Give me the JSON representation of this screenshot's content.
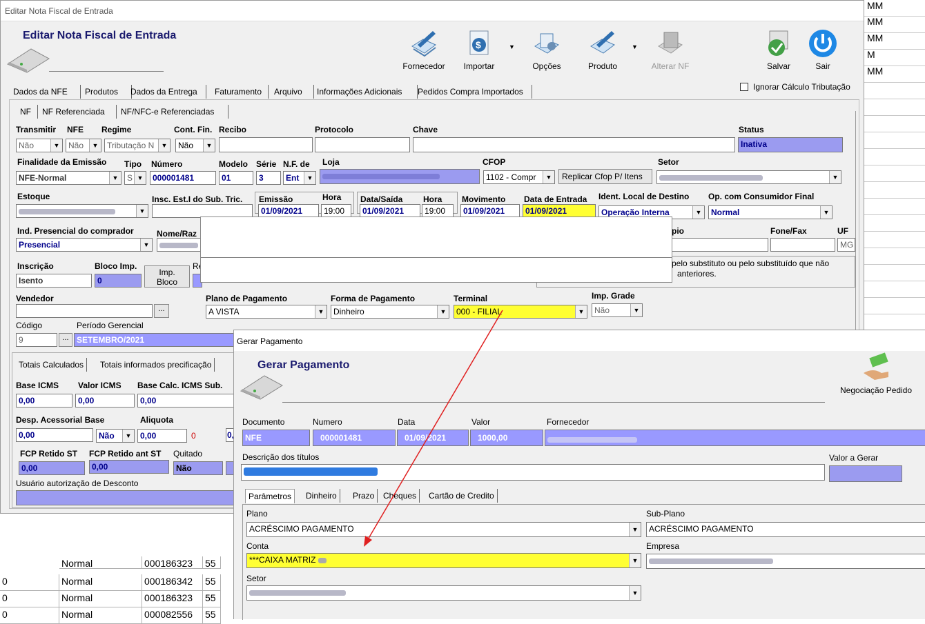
{
  "bg": {
    "right_col_items": [
      "MM",
      "MM",
      "M",
      "MM"
    ],
    "rows": [
      {
        "a": "0",
        "b": "Normal",
        "c": "000186342",
        "d": "55"
      },
      {
        "a": "0",
        "b": "Normal",
        "c": "000186323",
        "d": "55"
      },
      {
        "a": "0",
        "b": "Normal",
        "c": "000082556",
        "d": "55"
      }
    ],
    "partial_row": {
      "b": "Normal",
      "c": "000186323",
      "d": "55"
    }
  },
  "main": {
    "window_title": "Editar Nota Fiscal de Entrada",
    "header_title": "Editar Nota Fiscal de Entrada",
    "toolbar": {
      "fornecedor": "Fornecedor",
      "importar": "Importar",
      "opcoes": "Opções",
      "produto": "Produto",
      "alterar_nf": "Alterar NF",
      "salvar": "Salvar",
      "sair": "Sair"
    },
    "ignorar": "Ignorar Cálculo Tributação",
    "tabs": [
      "Dados da NFE",
      "Produtos",
      "Dados da Entrega",
      "Faturamento",
      "Arquivo",
      "Informações Adicionais",
      "Pedidos Compra Importados"
    ],
    "subtabs": [
      "NF",
      "NF Referenciada",
      "NF/NFC-e Referenciadas"
    ],
    "r1": {
      "transmitir_lbl": "Transmitir",
      "nfe_lbl": "NFE",
      "regime_lbl": "Regime",
      "contfin_lbl": "Cont. Fin.",
      "recibo_lbl": "Recibo",
      "protocolo_lbl": "Protocolo",
      "chave_lbl": "Chave",
      "status_lbl": "Status",
      "transmitir": "Não",
      "nfe": "Não",
      "regime": "Tributação N",
      "contfin": "Não",
      "status": "Inativa"
    },
    "r2": {
      "finalidade_lbl": "Finalidade da Emissão",
      "tipo_lbl": "Tipo",
      "numero_lbl": "Número",
      "modelo_lbl": "Modelo",
      "serie_lbl": "Série",
      "nfde_lbl": "N.F. de",
      "loja_lbl": "Loja",
      "cfop_lbl": "CFOP",
      "setor_lbl": "Setor",
      "finalidade": "NFE-Normal",
      "tipo": "S",
      "numero": "000001481",
      "modelo": "01",
      "serie": "3",
      "nfde": "Ent",
      "cfop": "1102 - Compr",
      "replicar": "Replicar Cfop P/ Itens"
    },
    "r3": {
      "estoque_lbl": "Estoque",
      "insc_sub_lbl": "Insc. Est.I do Sub. Tric.",
      "emissao_lbl": "Emissão",
      "hora_lbl": "Hora",
      "datasaida_lbl": "Data/Saída",
      "hora2_lbl": "Hora",
      "movimento_lbl": "Movimento",
      "dataentrada_lbl": "Data de Entrada",
      "ident_lbl": "Ident. Local de Destino",
      "opcons_lbl": "Op. com Consumidor Final",
      "emissao": "01/09/2021",
      "hora": "19:00",
      "datasaida": "01/09/2021",
      "hora2": "19:00",
      "movimento": "01/09/2021",
      "dataentrada": "01/09/2021",
      "ident": "Operação Interna",
      "opcons": "Normal"
    },
    "r4": {
      "indpres_lbl": "Ind. Presencial do comprador",
      "nomeraz_lbl": "Nome/Raz",
      "municipio_lbl": "pio",
      "fone_lbl": "Fone/Fax",
      "uf_lbl": "UF",
      "indpres": "Presencial",
      "uf": "MG"
    },
    "r5": {
      "inscricao_lbl": "Inscrição",
      "bloco_lbl": "Bloco Imp.",
      "re_lbl": "Re",
      "inscricao": "Isento",
      "bloco": "0",
      "imp_bloco": "Imp.\nBloco",
      "info_text1": "pelo substituto ou pelo substituído que não",
      "info_text2": "anteriores."
    },
    "r6": {
      "vendedor_lbl": "Vendedor",
      "plano_lbl": "Plano de Pagamento",
      "forma_lbl": "Forma de Pagamento",
      "terminal_lbl": "Terminal",
      "impgrade_lbl": "Imp. Grade",
      "plano": "A VISTA",
      "forma": "Dinheiro",
      "terminal": "000 - FILIAL",
      "impgrade": "Não"
    },
    "r7": {
      "codigo_lbl": "Código",
      "periodo_lbl": "Período Gerencial",
      "codigo": "9",
      "periodo": "SETEMBRO/2021"
    },
    "tot_tabs": [
      "Totais Calculados",
      "Totais informados precificação"
    ],
    "tot": {
      "base_icms_lbl": "Base ICMS",
      "valor_icms_lbl": "Valor ICMS",
      "base_sub_lbl": "Base Calc. ICMS Sub.",
      "base_icms": "0,00",
      "valor_icms": "0,00",
      "base_sub": "0,00",
      "desp_lbl": "Desp. Acessorial Base",
      "aliquota_lbl": "Aliquota",
      "desp": "0,00",
      "desp_sel": "Não",
      "aliquota": "0,00",
      "aliq_zero": "0",
      "fcp_lbl": "FCP Retido ST",
      "fcp_ant_lbl": "FCP Retido ant ST",
      "quitado_lbl": "Quitado",
      "fcp": "0,00",
      "fcp_ant": "0,00",
      "quitado": "Não",
      "usuario_lbl": "Usuário autorização de Desconto"
    }
  },
  "gerar": {
    "window_title": "Gerar Pagamento",
    "header_title": "Gerar Pagamento",
    "negociacao": "Negociação Pedido",
    "documento_lbl": "Documento",
    "numero_lbl": "Numero",
    "data_lbl": "Data",
    "valor_lbl": "Valor",
    "fornecedor_lbl": "Fornecedor",
    "documento": "NFE",
    "numero": "000001481",
    "data": "01/09/2021",
    "valor": "1000,00",
    "descricao_lbl": "Descrição dos títulos",
    "valor_gerar_lbl": "Valor a Gerar",
    "tabs": [
      "Parâmetros",
      "Dinheiro",
      "Prazo",
      "Cheques",
      "Cartão de Credito"
    ],
    "plano_lbl": "Plano",
    "plano": "ACRÉSCIMO PAGAMENTO",
    "subplano_lbl": "Sub-Plano",
    "subplano": "ACRÉSCIMO PAGAMENTO",
    "conta_lbl": "Conta",
    "conta": "***CAIXA MATRIZ",
    "empresa_lbl": "Empresa",
    "setor_lbl": "Setor"
  },
  "colors": {
    "highlight": "#ffff33",
    "field_blue": "#9999ff",
    "arrow": "#e02020"
  }
}
